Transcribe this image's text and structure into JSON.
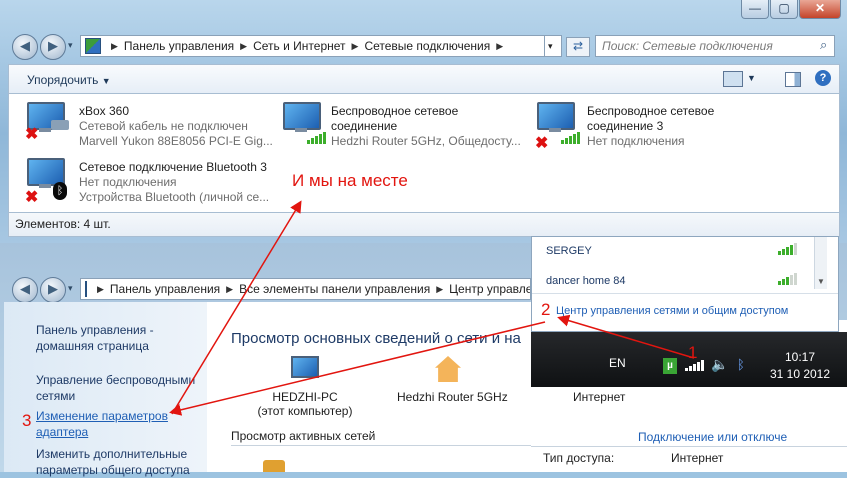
{
  "window_top": {
    "breadcrumb": [
      "Панель управления",
      "Сеть и Интернет",
      "Сетевые подключения"
    ],
    "search_placeholder": "Поиск: Сетевые подключения",
    "toolbar": {
      "organize_label": "Упорядочить"
    },
    "connections": [
      {
        "name": "xBox 360",
        "status": "Сетевой кабель не подключен",
        "device": "Marvell Yukon 88E8056 PCI-E Gig..."
      },
      {
        "name": "Беспроводное сетевое",
        "name2": "соединение",
        "status": "Hedzhi Router 5GHz, Общедосту..."
      },
      {
        "name": "Беспроводное сетевое",
        "name2": "соединение 3",
        "status": "Нет подключения"
      },
      {
        "name": "Сетевое подключение Bluetooth 3",
        "status": "Нет подключения",
        "device": "Устройства Bluetooth (личной се..."
      }
    ],
    "status_bar": "Элементов: 4 шт."
  },
  "window_bottom": {
    "breadcrumb": [
      "Панель управления",
      "Все элементы панели управления",
      "Центр управле..."
    ],
    "sidebar": [
      {
        "line1": "Панель управления -",
        "line2": "домашняя страница"
      },
      {
        "line1": "Управление беспроводными",
        "line2": "сетями"
      },
      {
        "line1": "Изменение параметров",
        "line2": "адаптера"
      },
      {
        "line1": "Изменить дополнительные",
        "line2": "параметры общего доступа"
      }
    ],
    "main_title": "Просмотр основных сведений о сети и на",
    "map": {
      "pc_name": "HEDZHI-PC",
      "pc_sub": "(этот компьютер)",
      "router": "Hedzhi Router 5GHz",
      "internet": "Интернет"
    },
    "active_networks": "Просмотр активных сетей",
    "connect_disconnect": "Подключение или отключе",
    "access_type_label": "Тип доступа:",
    "access_type_value": "Интернет"
  },
  "wifi_popup": {
    "networks": [
      "SERGEY",
      "dancer home 84"
    ],
    "center_link": "Центр управления сетями и общим доступом"
  },
  "tray": {
    "lang": "EN",
    "time": "10:17",
    "date": "31 10 2012"
  },
  "annotations": {
    "arrival": "И мы на месте",
    "step1": "1",
    "step2": "2",
    "step3": "3"
  },
  "colors": {
    "annotation": "#e2150f",
    "link": "#1f5fb5",
    "bars": "#3cae2b"
  }
}
